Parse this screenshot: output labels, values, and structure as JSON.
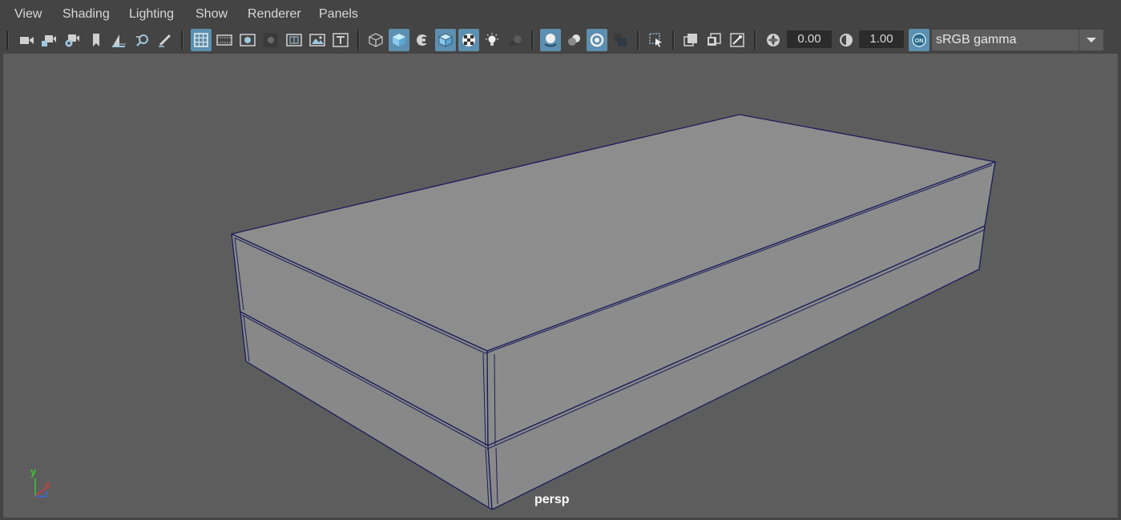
{
  "menu": [
    "View",
    "Shading",
    "Lighting",
    "Show",
    "Renderer",
    "Panels"
  ],
  "toolbar": {
    "exposure_value": "0.00",
    "gamma_value": "1.00",
    "color_management_badge": "ON",
    "color_space": "sRGB gamma",
    "icons": [
      "select-camera-icon",
      "camera-attributes-icon",
      "camera-settings-icon",
      "bookmark-icon",
      "image-plane-icon",
      "2d-pan-zoom-icon",
      "grease-pencil-icon",
      "grid-icon",
      "film-gate-icon",
      "resolution-gate-icon",
      "gate-mask-icon",
      "field-chart-icon",
      "safe-action-icon",
      "safe-title-icon",
      "wireframe-icon",
      "smooth-shade-icon",
      "default-material-icon",
      "wireframe-on-shaded-icon",
      "textured-icon",
      "use-all-lights-icon",
      "shadows-icon",
      "screen-space-ao-icon",
      "motion-blur-icon",
      "anti-aliasing-icon",
      "depth-of-field-icon",
      "isolate-select-icon",
      "xray-icon",
      "xray-active-components-icon",
      "xray-joints-icon",
      "exposure-icon",
      "gamma-icon",
      "color-management-icon"
    ],
    "active_icons": [
      "grid-icon",
      "smooth-shade-icon",
      "wireframe-on-shaded-icon",
      "textured-icon",
      "screen-space-ao-icon",
      "anti-aliasing-icon"
    ]
  },
  "viewport": {
    "camera": "persp",
    "axis": {
      "y": "y",
      "x": "x",
      "z": "z"
    },
    "background_color": "#5d5d5d",
    "object_color": "#8e8e8e",
    "wire_color": "#1c1c5a"
  },
  "colors": {
    "ui_background": "#444444",
    "active_button": "#5c8fb0",
    "menu_text": "#d8d8d8"
  }
}
